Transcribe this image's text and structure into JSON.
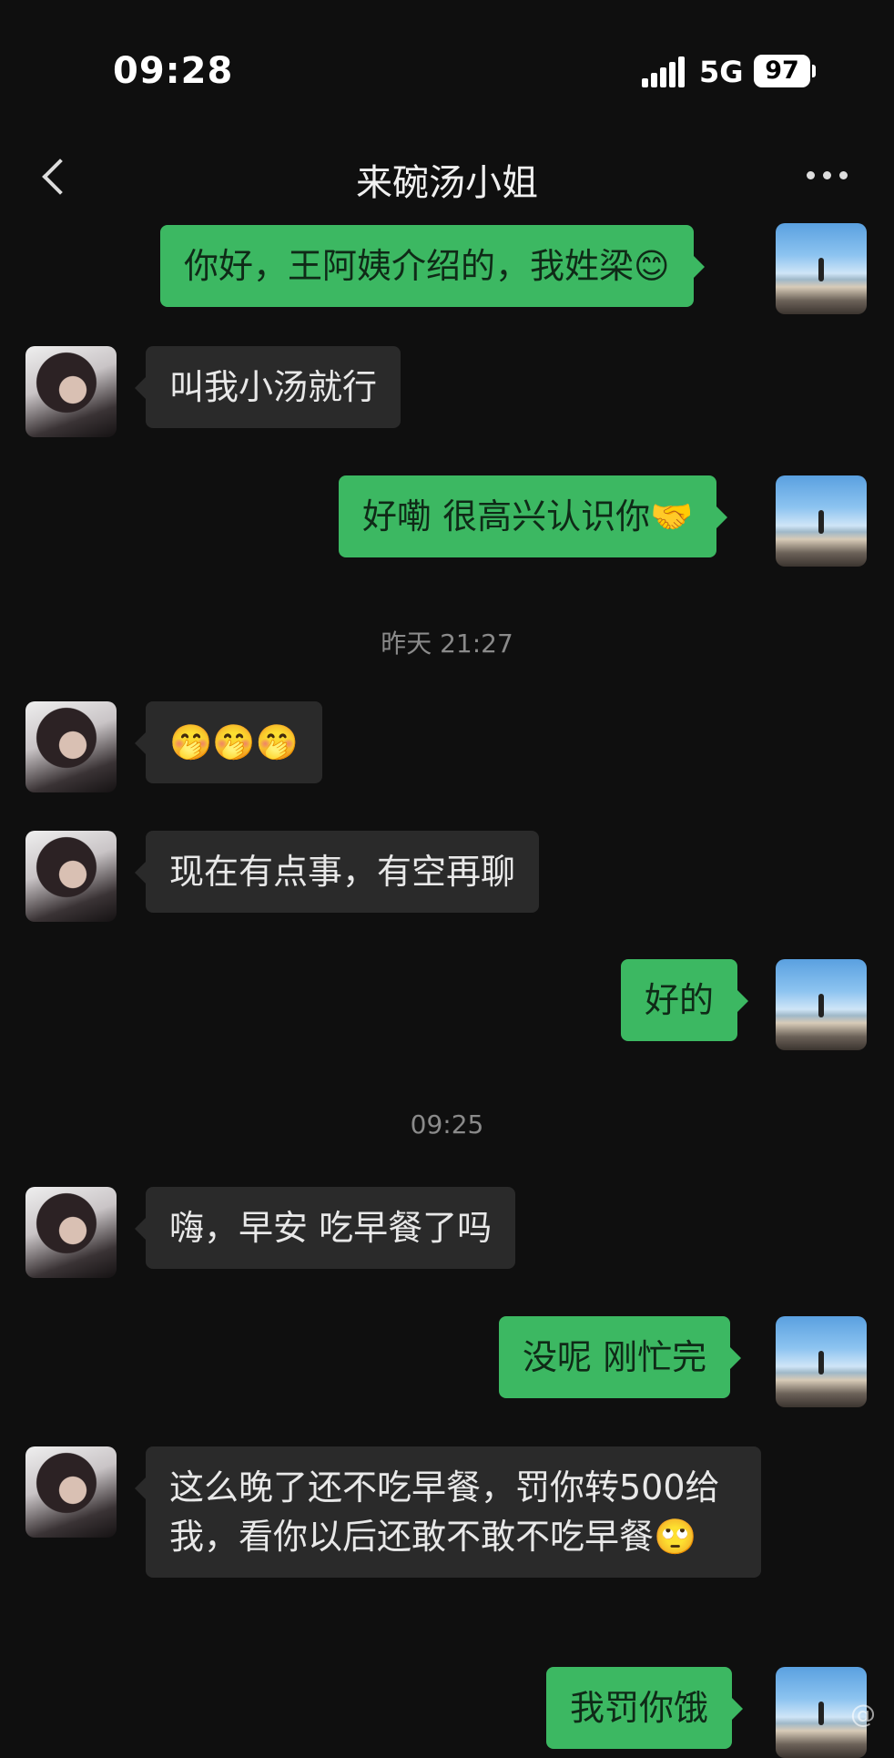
{
  "status": {
    "time": "09:28",
    "network": "5G",
    "battery": "97"
  },
  "nav": {
    "title": "来碗汤小姐"
  },
  "messages": [
    {
      "from": "me",
      "text": "你好，王阿姨介绍的，我姓梁😊"
    },
    {
      "from": "her",
      "text": "叫我小汤就行"
    },
    {
      "from": "me",
      "text": "好嘞 很高兴认识你🤝"
    },
    {
      "type": "time",
      "text": "昨天 21:27"
    },
    {
      "from": "her",
      "text": "🤭🤭🤭"
    },
    {
      "from": "her",
      "text": "现在有点事，有空再聊"
    },
    {
      "from": "me",
      "text": "好的"
    },
    {
      "type": "time",
      "text": "09:25"
    },
    {
      "from": "her",
      "text": "嗨，早安 吃早餐了吗"
    },
    {
      "from": "me",
      "text": "没呢 刚忙完"
    },
    {
      "from": "her",
      "text": "这么晚了还不吃早餐，罚你转500给我，看你以后还敢不敢不吃早餐🙄"
    },
    {
      "from": "me",
      "text": "我罚你饿"
    }
  ],
  "watermark": "@"
}
